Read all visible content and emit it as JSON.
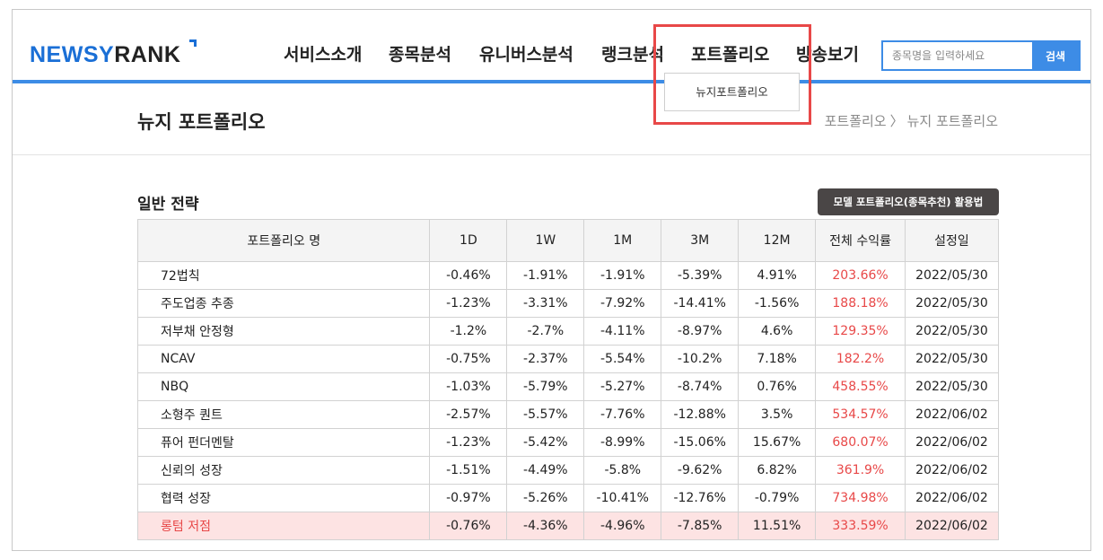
{
  "header": {
    "logo_part1": "NEWSY",
    "logo_part2": "RANK",
    "nav": [
      "서비스소개",
      "종목분석",
      "유니버스분석",
      "랭크분석",
      "포트폴리오",
      "방송보기"
    ],
    "search_placeholder": "종목명을 입력하세요",
    "search_button": "검색",
    "dropdown_item": "뉴지포트폴리오"
  },
  "page": {
    "title": "뉴지 포트폴리오",
    "breadcrumb": [
      "포트폴리오",
      "뉴지 포트폴리오"
    ]
  },
  "section": {
    "title": "일반 전략",
    "guide_button": "모델 포트폴리오(종목추천) 활용법"
  },
  "table": {
    "headers": [
      "포트폴리오 명",
      "1D",
      "1W",
      "1M",
      "3M",
      "12M",
      "전체 수익률",
      "설정일"
    ],
    "rows": [
      [
        "72법칙",
        "-0.46%",
        "-1.91%",
        "-1.91%",
        "-5.39%",
        "4.91%",
        "203.66%",
        "2022/05/30"
      ],
      [
        "주도업종 추종",
        "-1.23%",
        "-3.31%",
        "-7.92%",
        "-14.41%",
        "-1.56%",
        "188.18%",
        "2022/05/30"
      ],
      [
        "저부채 안정형",
        "-1.2%",
        "-2.7%",
        "-4.11%",
        "-8.97%",
        "4.6%",
        "129.35%",
        "2022/05/30"
      ],
      [
        "NCAV",
        "-0.75%",
        "-2.37%",
        "-5.54%",
        "-10.2%",
        "7.18%",
        "182.2%",
        "2022/05/30"
      ],
      [
        "NBQ",
        "-1.03%",
        "-5.79%",
        "-5.27%",
        "-8.74%",
        "0.76%",
        "458.55%",
        "2022/05/30"
      ],
      [
        "소형주 퀀트",
        "-2.57%",
        "-5.57%",
        "-7.76%",
        "-12.88%",
        "3.5%",
        "534.57%",
        "2022/06/02"
      ],
      [
        "퓨어 펀더멘탈",
        "-1.23%",
        "-5.42%",
        "-8.99%",
        "-15.06%",
        "15.67%",
        "680.07%",
        "2022/06/02"
      ],
      [
        "신뢰의 성장",
        "-1.51%",
        "-4.49%",
        "-5.8%",
        "-9.62%",
        "6.82%",
        "361.9%",
        "2022/06/02"
      ],
      [
        "협력 성장",
        "-0.97%",
        "-5.26%",
        "-10.41%",
        "-12.76%",
        "-0.79%",
        "734.98%",
        "2022/06/02"
      ],
      [
        "롱텀 저점",
        "-0.76%",
        "-4.36%",
        "-4.96%",
        "-7.85%",
        "11.51%",
        "333.59%",
        "2022/06/02"
      ]
    ],
    "highlighted_row_index": 9
  },
  "colors": {
    "accent": "#3d8ce6",
    "logo_blue": "#1a6fd6",
    "highlight_red": "#e84848",
    "highlight_row_bg": "#fde3e3"
  }
}
